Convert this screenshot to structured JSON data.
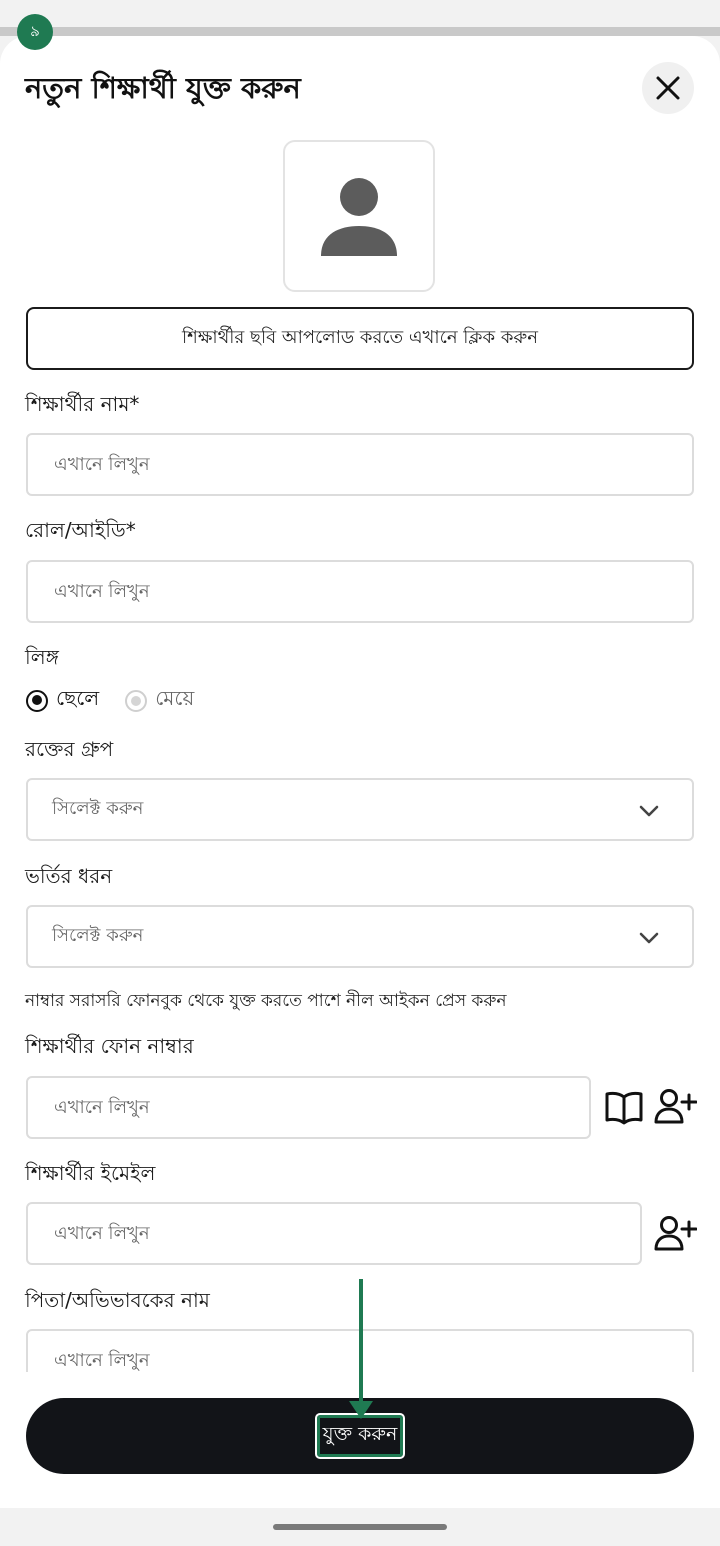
{
  "step_badge": "৯",
  "title": "নতুন শিক্ষার্থী যুক্ত করুন",
  "upload_label": "শিক্ষার্থীর ছবি আপলোড করতে এখানে ক্লিক করুন",
  "fields": {
    "name_label": "শিক্ষার্থীর নাম*",
    "name_placeholder": "এখানে লিখুন",
    "roll_label": "রোল/আইডি*",
    "roll_placeholder": "এখানে লিখুন",
    "gender_label": "লিঙ্গ",
    "gender_options": [
      "ছেলে",
      "মেয়ে"
    ],
    "blood_label": "রক্তের গ্রুপ",
    "blood_value": "সিলেক্ট করুন",
    "admission_label": "ভর্তির ধরন",
    "admission_value": "সিলেক্ট করুন",
    "phone_hint": "নাম্বার সরাসরি ফোনবুক থেকে যুক্ত করতে পাশে নীল আইকন প্রেস করুন",
    "phone_label": "শিক্ষার্থীর ফোন নাম্বার",
    "phone_placeholder": "এখানে লিখুন",
    "email_label": "শিক্ষার্থীর ইমেইল",
    "email_placeholder": "এখানে লিখুন",
    "guardian_label": "পিতা/অভিভাবকের নাম",
    "guardian_placeholder": "এখানে লিখুন"
  },
  "submit_label": "যুক্ত করুন",
  "icons": {
    "close": "close-icon",
    "avatar": "person-icon",
    "chevron": "chevron-down-icon",
    "phonebook": "book-icon",
    "add_contact": "person-add-icon"
  },
  "colors": {
    "accent": "#1f7a52",
    "button_dark": "#121418"
  }
}
